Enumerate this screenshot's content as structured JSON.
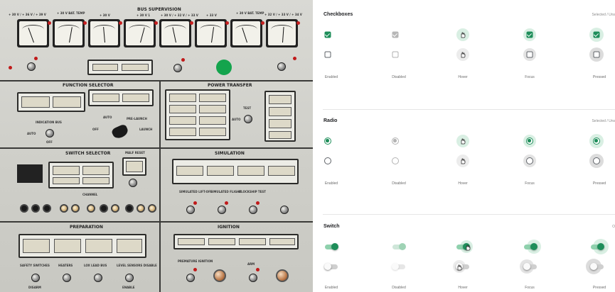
{
  "panel": {
    "title": "BUS SUPERVISION",
    "meter_labels": [
      "+ 30 V / + 36 V / + 39 V",
      "+ 30 V BAT. TEMP",
      "+ 30 V",
      "+ 30 V 1",
      "+ 30 V / + 32 V / + 33 V",
      "+ 33 V",
      "+ 30 V BAT. TEMP",
      "+ 32 V / + 33 V / + 34 V"
    ],
    "sections": {
      "function_selector": "FUNCTION SELECTOR",
      "power_transfer": "POWER TRANSFER",
      "switch_selector": "SWITCH SELECTOR",
      "simulation": "SIMULATION",
      "preparation": "PREPARATION",
      "ignition": "IGNITION"
    },
    "small_labels": {
      "indication_bus": "INDICATION BUS",
      "auto": "AUTO",
      "off": "OFF",
      "pre_launch": "PRE-LAUNCH",
      "launch": "LAUNCH",
      "test": "TEST",
      "malf_reset": "MALF RESET",
      "channel": "CHANNEL",
      "simulated_lift_off": "SIMULATED LIFT-OFF",
      "simulated_flight": "SIMULATED FLIGHT",
      "blockship_test": "BLOCKSHIP TEST",
      "safety_switches": "SAFETY SWITCHES",
      "heaters": "HEATERS",
      "lox_lead_bus": "LOX LEAD BUS",
      "level_sensors": "LEVEL SENSORS DISABLE",
      "premature_ignition": "PREMATURE IGNITION",
      "disarm": "DISARM",
      "enable": "ENABLE",
      "arm": "ARM",
      "on": "ON"
    }
  },
  "states": {
    "columns": [
      "Enabled",
      "Disabled",
      "Hover",
      "Focus",
      "Pressed"
    ],
    "checkboxes": {
      "title": "Checkboxes",
      "meta": "Selected / Uns"
    },
    "radio": {
      "title": "Radio",
      "meta": "Selected / Uns"
    },
    "switch": {
      "title": "Switch",
      "meta": "O"
    },
    "colors": {
      "accent": "#1e8e5a",
      "accent_light": "#8fd1ad",
      "disabled": "#b7b7b7",
      "halo": "#d9efe3",
      "halo_neutral": "#e3e3e3"
    },
    "icons": [
      "hand-pointer-icon",
      "check-icon"
    ]
  }
}
